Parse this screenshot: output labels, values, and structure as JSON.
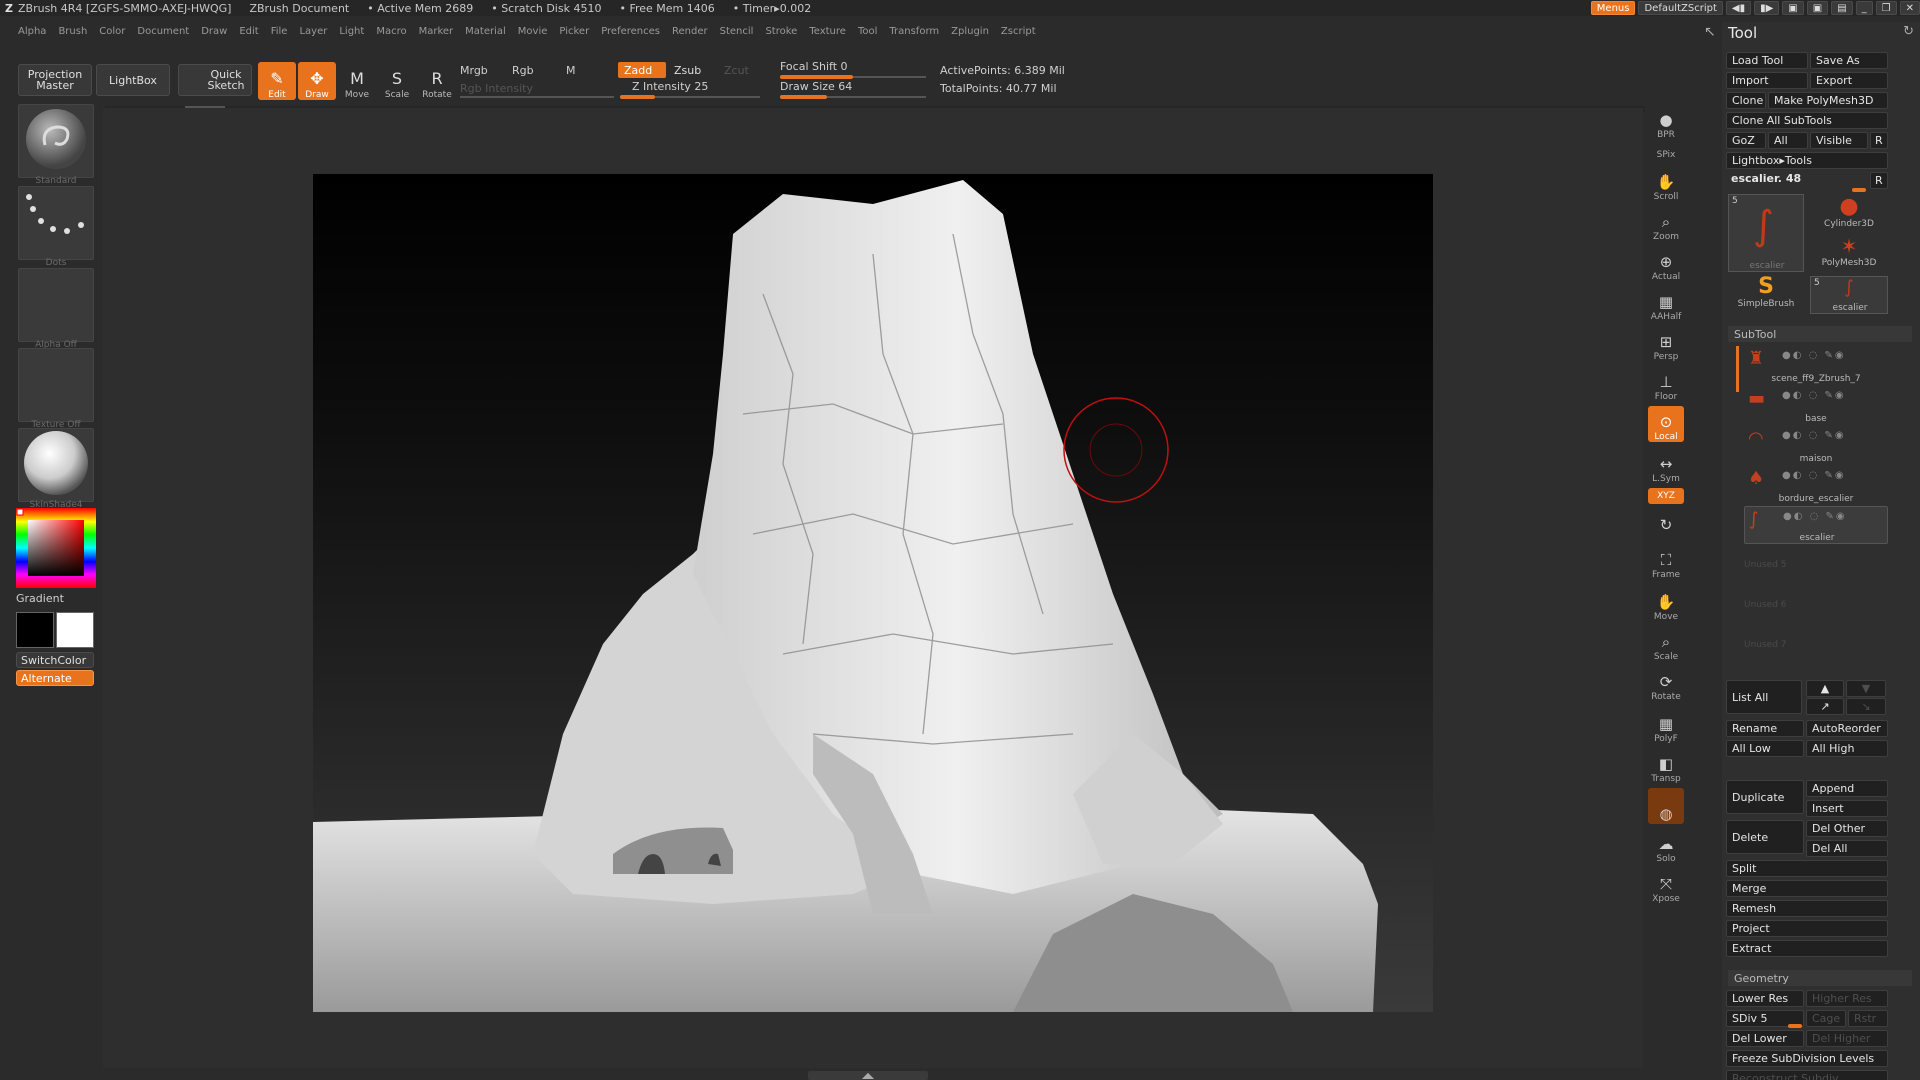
{
  "titlebar": {
    "app": "ZBrush 4R4 [ZGFS-SMMO-AXEJ-HWQG]",
    "doc": "ZBrush Document",
    "active_mem": "• Active Mem 2689",
    "scratch": "• Scratch Disk 4510",
    "free_mem": "• Free Mem 1406",
    "timer": "• Timer▸0.002",
    "menus": "Menus",
    "script": "DefaultZScript"
  },
  "menubar": [
    "Alpha",
    "Brush",
    "Color",
    "Document",
    "Draw",
    "Edit",
    "File",
    "Layer",
    "Light",
    "Macro",
    "Marker",
    "Material",
    "Movie",
    "Picker",
    "Preferences",
    "Render",
    "Stencil",
    "Stroke",
    "Texture",
    "Tool",
    "Transform",
    "Zplugin",
    "Zscript"
  ],
  "toolbar": {
    "projection_master": "Projection Master",
    "lightbox": "LightBox",
    "quick_sketch": "Quick Sketch",
    "edit": "Edit",
    "draw": "Draw",
    "move": "Move",
    "scale": "Scale",
    "rotate": "Rotate",
    "mrgb": "Mrgb",
    "rgb": "Rgb",
    "m": "M",
    "rgb_intensity": "Rgb Intensity",
    "zadd": "Zadd",
    "zsub": "Zsub",
    "zcut": "Zcut",
    "z_intensity": "Z Intensity 25",
    "focal_shift": "Focal Shift 0",
    "draw_size": "Draw Size 64",
    "active_points": "ActivePoints: 6.389 Mil",
    "total_points": "TotalPoints: 40.77 Mil",
    "z_intensity_value": 25,
    "focal_shift_value": 0,
    "draw_size_value": 64
  },
  "leftshelf": {
    "brush": "Standard",
    "stroke": "Dots",
    "alpha": "Alpha Off",
    "texture": "Texture Off",
    "material": "SkinShade4",
    "gradient": "Gradient",
    "switchcolor": "SwitchColor",
    "alternate": "Alternate"
  },
  "rightcol": [
    "BPR",
    "SPix",
    "Scroll",
    "Zoom",
    "Actual",
    "AAHalf",
    "Persp",
    "Floor",
    "Local",
    "L.Sym",
    "XYZ",
    "Frame",
    "Move",
    "Scale",
    "Rotate",
    "PolyF",
    "Transp",
    "Solo",
    "Xpose"
  ],
  "tool": {
    "title": "Tool",
    "load_tool": "Load Tool",
    "save_as": "Save As",
    "import": "Import",
    "export": "Export",
    "clone": "Clone",
    "make_polymesh": "Make PolyMesh3D",
    "clone_all": "Clone All SubTools",
    "goz": "GoZ",
    "all": "All",
    "visible": "Visible",
    "r": "R",
    "lightbox_tools": "Lightbox▸Tools",
    "current_tool": "escalier. 48",
    "thumb_current": "escalier",
    "thumb_cylinder": "Cylinder3D",
    "thumb_polymesh": "PolyMesh3D",
    "thumb_simplebrush": "SimpleBrush",
    "thumb_escalier": "escalier",
    "badge_count": "5"
  },
  "subtool": {
    "header": "SubTool",
    "items": [
      "scene_ff9_Zbrush_7",
      "base",
      "maison",
      "bordure_escalier",
      "escalier"
    ],
    "unused": [
      "Unused 5",
      "Unused 6",
      "Unused 7"
    ],
    "list_all": "List All",
    "rename": "Rename",
    "autoreorder": "AutoReorder",
    "all_low": "All Low",
    "all_high": "All High",
    "duplicate": "Duplicate",
    "append": "Append",
    "insert": "Insert",
    "delete": "Delete",
    "del_other": "Del Other",
    "del_all": "Del All",
    "split": "Split",
    "merge": "Merge",
    "remesh": "Remesh",
    "project": "Project",
    "extract": "Extract"
  },
  "geometry": {
    "header": "Geometry",
    "lower_res": "Lower Res",
    "higher_res": "Higher Res",
    "sdiv": "SDiv 5",
    "cage": "Cage",
    "rstr": "Rstr",
    "del_lower": "Del Lower",
    "del_higher": "Del Higher",
    "freeze": "Freeze SubDivision Levels",
    "reconstruct": "Reconstruct Subdiv"
  },
  "colors": {
    "accent": "#e8731c",
    "panel": "#2f2f2f",
    "bg": "#2b2b2b"
  }
}
